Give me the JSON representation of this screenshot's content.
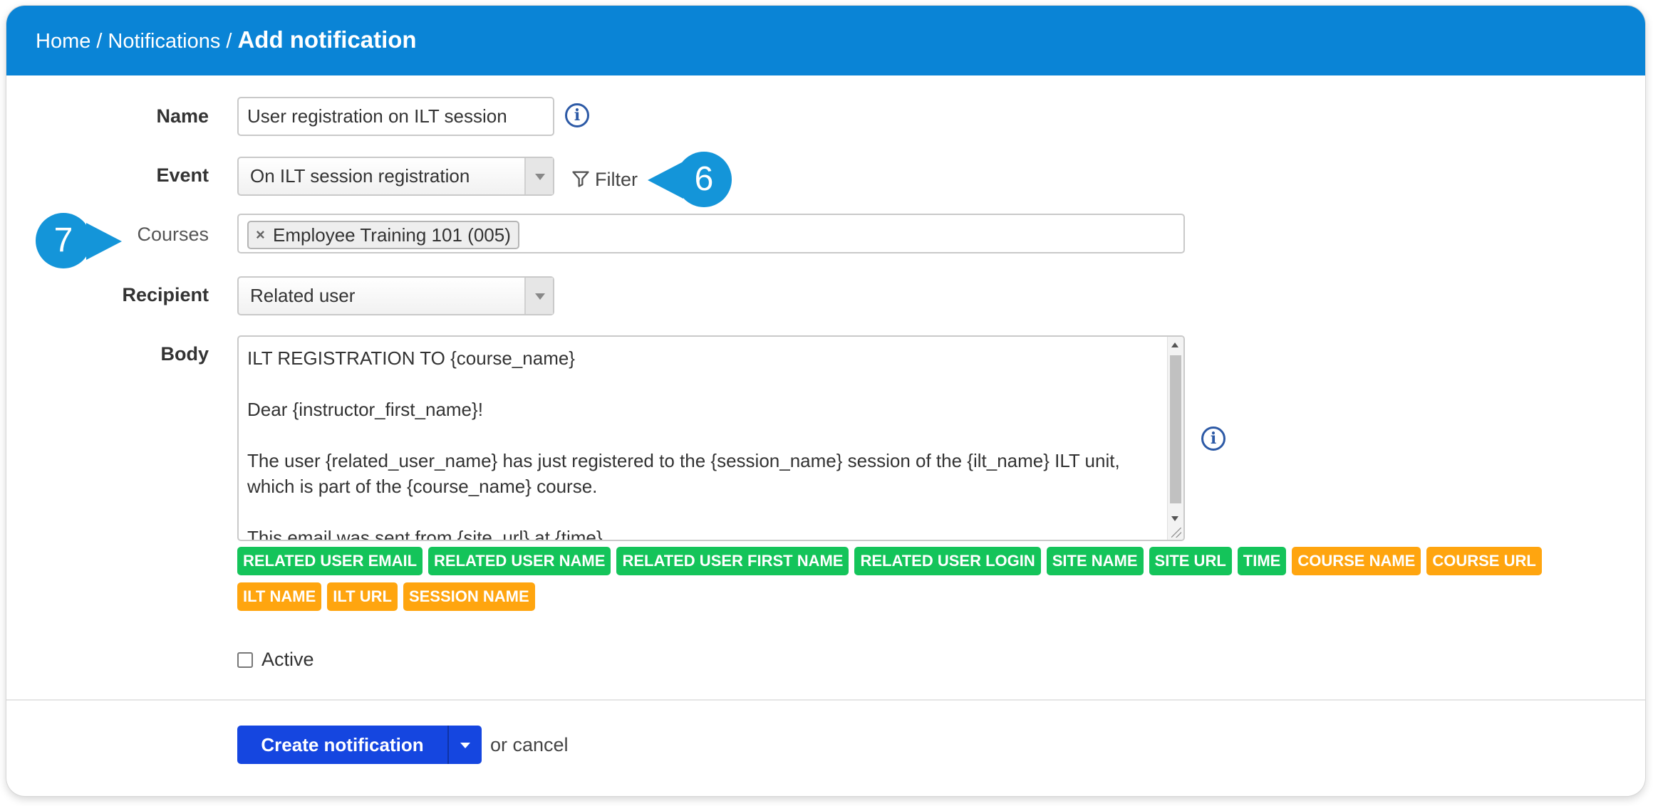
{
  "header": {
    "breadcrumb": [
      {
        "label": "Home"
      },
      {
        "label": "Notifications"
      }
    ],
    "separator": "/",
    "current": "Add notification"
  },
  "form": {
    "name": {
      "label": "Name",
      "value": "User registration on ILT session",
      "info_icon": "info-icon"
    },
    "event": {
      "label": "Event",
      "value": "On ILT session registration",
      "filter_label": "Filter",
      "filter_icon": "filter-icon"
    },
    "courses": {
      "label": "Courses",
      "tags": [
        "Employee Training 101 (005)"
      ],
      "remove_glyph": "×"
    },
    "recipient": {
      "label": "Recipient",
      "value": "Related user"
    },
    "body": {
      "label": "Body",
      "lines": [
        "ILT REGISTRATION TO {course_name}",
        "",
        "Dear {instructor_first_name}!",
        "",
        "The user {related_user_name} has just registered to the {session_name} session of the {ilt_name} ILT unit,",
        "which is part of the {course_name} course.",
        "",
        "This email was sent from {site_url} at {time}"
      ],
      "info_icon": "info-icon"
    },
    "placeholders": [
      {
        "label": "RELATED USER EMAIL",
        "color": "#14c45a"
      },
      {
        "label": "RELATED USER NAME",
        "color": "#14c45a"
      },
      {
        "label": "RELATED USER FIRST NAME",
        "color": "#14c45a"
      },
      {
        "label": "RELATED USER LOGIN",
        "color": "#14c45a"
      },
      {
        "label": "SITE NAME",
        "color": "#14c45a"
      },
      {
        "label": "SITE URL",
        "color": "#14c45a"
      },
      {
        "label": "TIME",
        "color": "#14c45a"
      },
      {
        "label": "COURSE NAME",
        "color": "#ffa50f"
      },
      {
        "label": "COURSE URL",
        "color": "#ffa50f"
      },
      {
        "label": "ILT NAME",
        "color": "#ffa50f"
      },
      {
        "label": "ILT URL",
        "color": "#ffa50f"
      },
      {
        "label": "SESSION NAME",
        "color": "#ffa50f"
      }
    ],
    "active": {
      "label": "Active",
      "checked": false
    }
  },
  "actions": {
    "create_label": "Create notification",
    "cancel_text": "or cancel"
  },
  "callouts": [
    {
      "number": "6"
    },
    {
      "number": "7"
    }
  ],
  "colors": {
    "header_bg": "#0a84d6",
    "primary_button": "#1546e0",
    "callout": "#1495d9",
    "info_icon": "#2d5aa6"
  }
}
